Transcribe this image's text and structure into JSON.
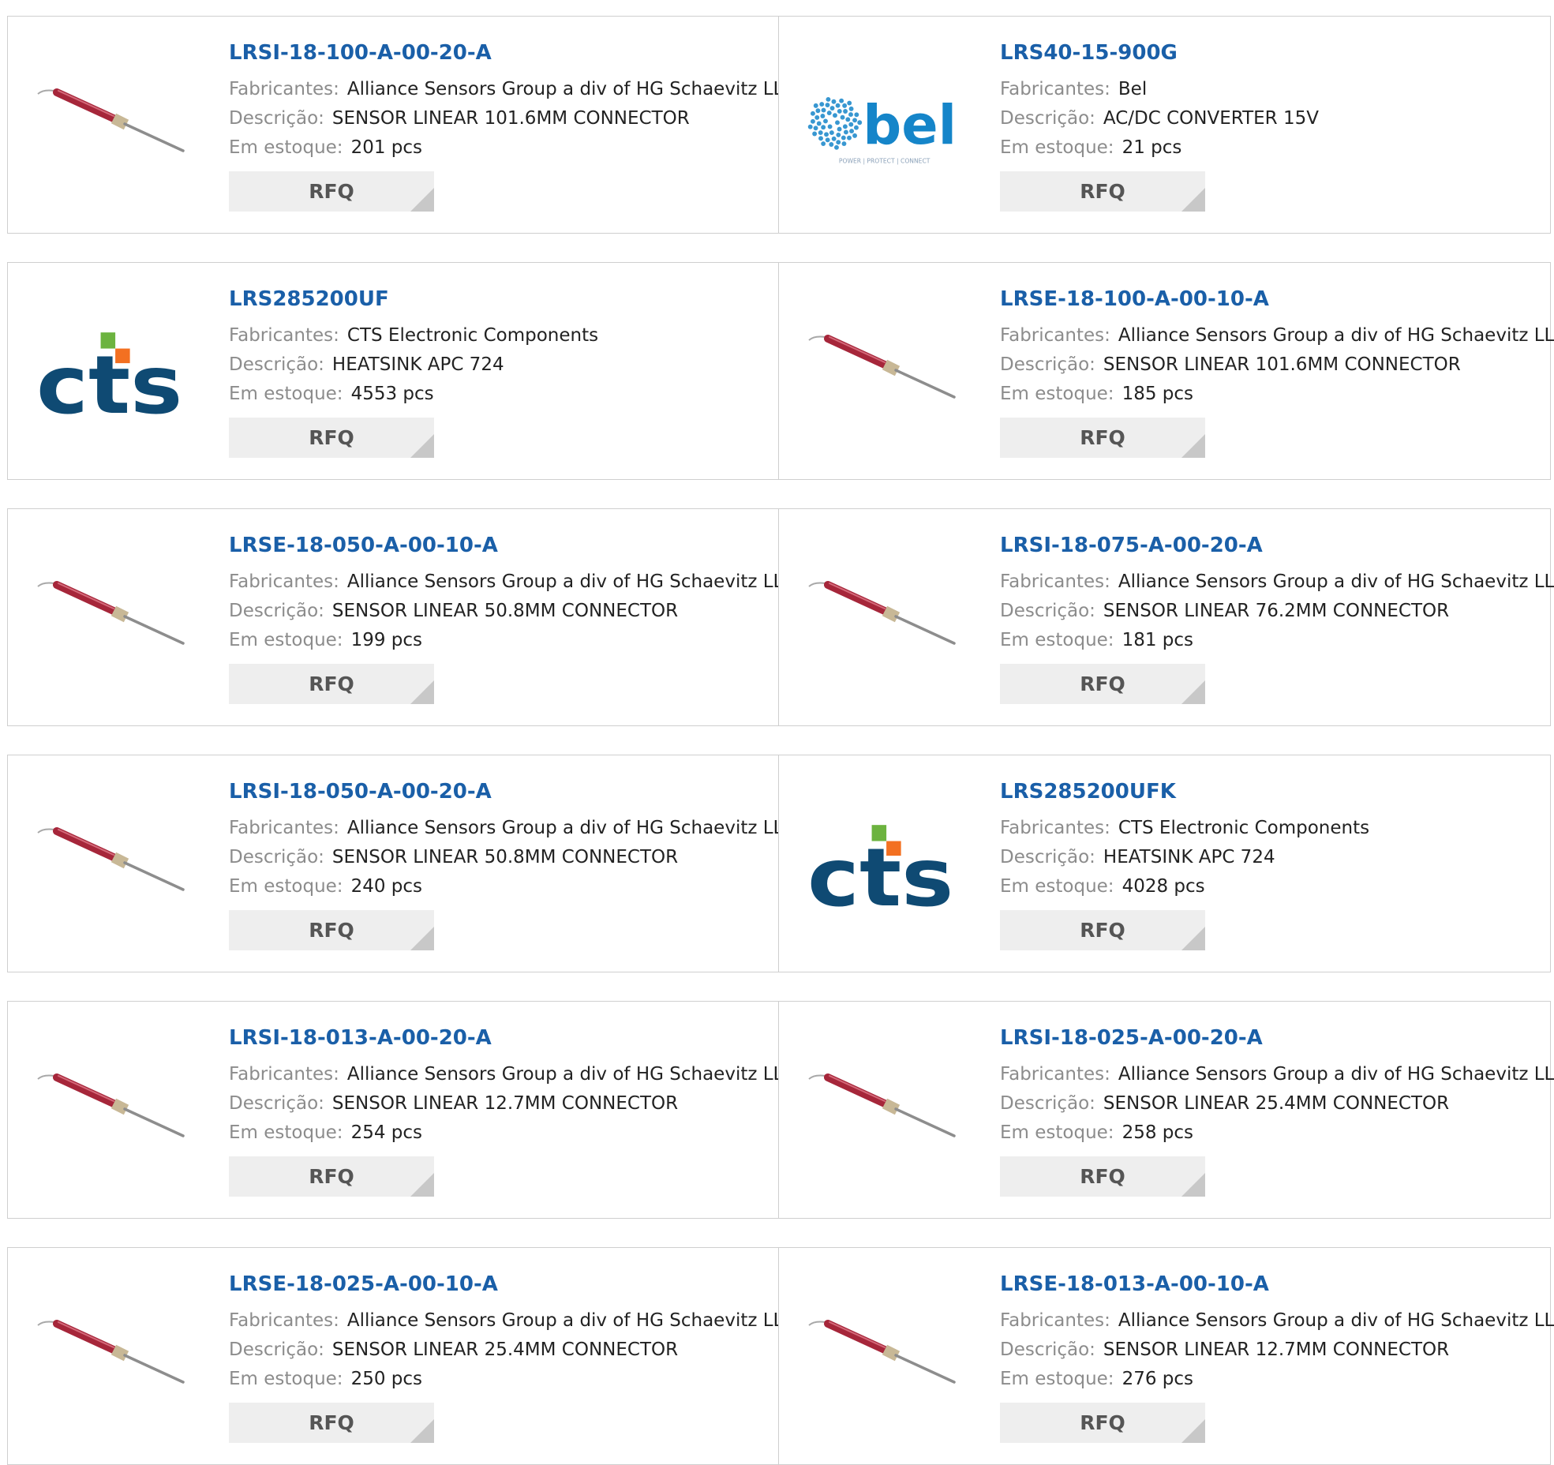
{
  "labels": {
    "manufacturer": "Fabricantes:",
    "description": "Descrição:",
    "stock": "Em estoque:",
    "rfq": "RFQ"
  },
  "logos": {
    "bel_text": "bel",
    "bel_tagline": "POWER | PROTECT | CONNECT",
    "cts_text": "cts"
  },
  "colors": {
    "link": "#1a5fa8",
    "sensor_body": "#a6263a",
    "bel_blue": "#1585c9",
    "cts_navy": "#0f4a73",
    "cts_green": "#6cb33f",
    "cts_orange": "#f37021"
  },
  "products": [
    {
      "part": "LRSI-18-100-A-00-20-A",
      "manufacturer": "Alliance Sensors Group a div of HG Schaevitz LLC",
      "description": "SENSOR LINEAR 101.6MM CONNECTOR",
      "stock": "201 pcs",
      "image": "sensor-probe"
    },
    {
      "part": "LRS40-15-900G",
      "manufacturer": "Bel",
      "description": "AC/DC CONVERTER 15V",
      "stock": "21 pcs",
      "image": "bel-logo"
    },
    {
      "part": "LRS285200UF",
      "manufacturer": "CTS Electronic Components",
      "description": "HEATSINK APC 724",
      "stock": "4553 pcs",
      "image": "cts-logo"
    },
    {
      "part": "LRSE-18-100-A-00-10-A",
      "manufacturer": "Alliance Sensors Group a div of HG Schaevitz LLC",
      "description": "SENSOR LINEAR 101.6MM CONNECTOR",
      "stock": "185 pcs",
      "image": "sensor-probe"
    },
    {
      "part": "LRSE-18-050-A-00-10-A",
      "manufacturer": "Alliance Sensors Group a div of HG Schaevitz LLC",
      "description": "SENSOR LINEAR 50.8MM CONNECTOR",
      "stock": "199 pcs",
      "image": "sensor-probe"
    },
    {
      "part": "LRSI-18-075-A-00-20-A",
      "manufacturer": "Alliance Sensors Group a div of HG Schaevitz LLC",
      "description": "SENSOR LINEAR 76.2MM CONNECTOR",
      "stock": "181 pcs",
      "image": "sensor-probe"
    },
    {
      "part": "LRSI-18-050-A-00-20-A",
      "manufacturer": "Alliance Sensors Group a div of HG Schaevitz LLC",
      "description": "SENSOR LINEAR 50.8MM CONNECTOR",
      "stock": "240 pcs",
      "image": "sensor-probe"
    },
    {
      "part": "LRS285200UFK",
      "manufacturer": "CTS Electronic Components",
      "description": "HEATSINK APC 724",
      "stock": "4028 pcs",
      "image": "cts-logo"
    },
    {
      "part": "LRSI-18-013-A-00-20-A",
      "manufacturer": "Alliance Sensors Group a div of HG Schaevitz LLC",
      "description": "SENSOR LINEAR 12.7MM CONNECTOR",
      "stock": "254 pcs",
      "image": "sensor-probe"
    },
    {
      "part": "LRSI-18-025-A-00-20-A",
      "manufacturer": "Alliance Sensors Group a div of HG Schaevitz LLC",
      "description": "SENSOR LINEAR 25.4MM CONNECTOR",
      "stock": "258 pcs",
      "image": "sensor-probe"
    },
    {
      "part": "LRSE-18-025-A-00-10-A",
      "manufacturer": "Alliance Sensors Group a div of HG Schaevitz LLC",
      "description": "SENSOR LINEAR 25.4MM CONNECTOR",
      "stock": "250 pcs",
      "image": "sensor-probe"
    },
    {
      "part": "LRSE-18-013-A-00-10-A",
      "manufacturer": "Alliance Sensors Group a div of HG Schaevitz LLC",
      "description": "SENSOR LINEAR 12.7MM CONNECTOR",
      "stock": "276 pcs",
      "image": "sensor-probe"
    }
  ]
}
